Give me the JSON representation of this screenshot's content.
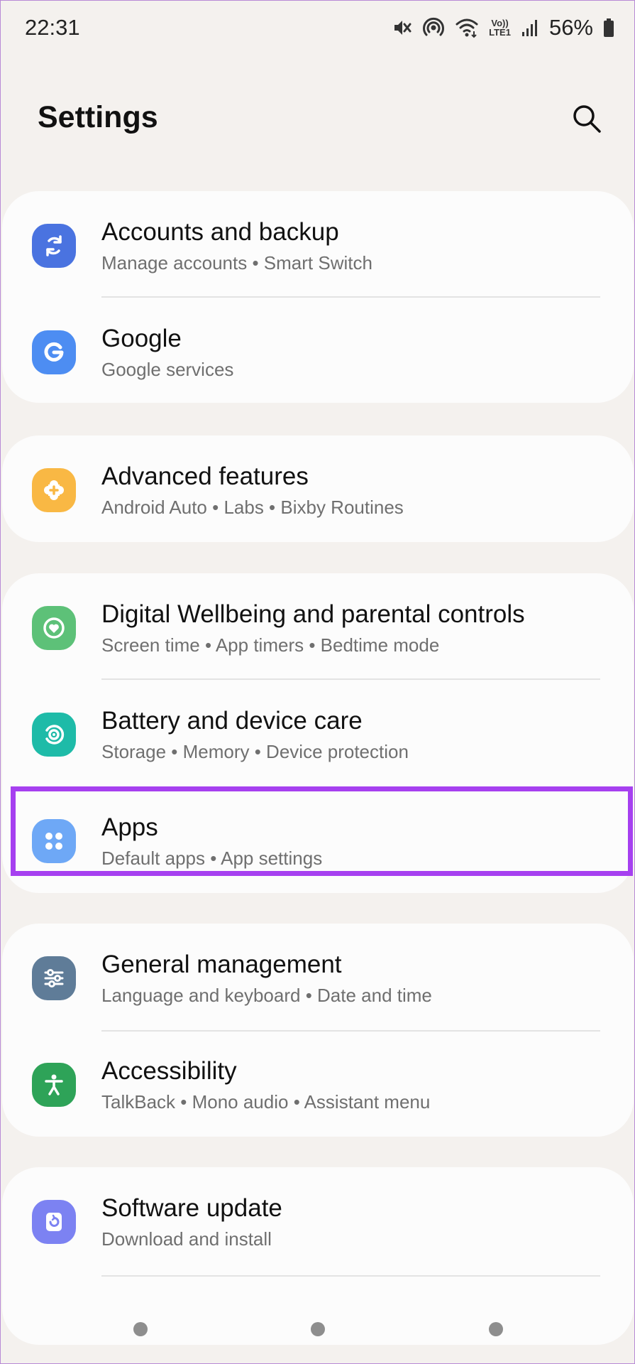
{
  "status_bar": {
    "time": "22:31",
    "volte_top": "Vo))",
    "volte_bottom": "LTE1",
    "battery": "56%",
    "icons": [
      "mute-icon",
      "hotspot-icon",
      "wifi-icon",
      "volte-icon",
      "signal-icon",
      "battery-icon"
    ]
  },
  "header": {
    "title": "Settings",
    "search_icon": "search-icon"
  },
  "groups": [
    {
      "items": [
        {
          "title": "Accounts and backup",
          "subtitle": "Manage accounts  •  Smart Switch",
          "icon": "sync-icon",
          "color": "#4a73e0"
        },
        {
          "title": "Google",
          "subtitle": "Google services",
          "icon": "google-icon",
          "color": "#4d8df2"
        }
      ]
    },
    {
      "items": [
        {
          "title": "Advanced features",
          "subtitle": "Android Auto  •  Labs  •  Bixby Routines",
          "icon": "puzzle-gear-icon",
          "color": "#f9b844"
        }
      ]
    },
    {
      "items": [
        {
          "title": "Digital Wellbeing and parental controls",
          "subtitle": "Screen time  •  App timers  •  Bedtime mode",
          "icon": "heart-circle-icon",
          "color": "#5dc178"
        },
        {
          "title": "Battery and device care",
          "subtitle": "Storage  •  Memory  •  Device protection",
          "icon": "device-care-icon",
          "color": "#1ebba8"
        },
        {
          "title": "Apps",
          "subtitle": "Default apps  •  App settings",
          "icon": "apps-grid-icon",
          "color": "#6ea8f6"
        }
      ]
    },
    {
      "items": [
        {
          "title": "General management",
          "subtitle": "Language and keyboard  •  Date and time",
          "icon": "sliders-icon",
          "color": "#5f7c98"
        },
        {
          "title": "Accessibility",
          "subtitle": "TalkBack  •  Mono audio  •  Assistant menu",
          "icon": "accessibility-icon",
          "color": "#2ea358"
        }
      ]
    },
    {
      "items": [
        {
          "title": "Software update",
          "subtitle": "Download and install",
          "icon": "update-icon",
          "color": "#7c82f2"
        }
      ]
    }
  ],
  "highlight_color": "#a640f0",
  "nav_bar": {
    "buttons": [
      "recents-button",
      "home-button",
      "back-button"
    ]
  }
}
